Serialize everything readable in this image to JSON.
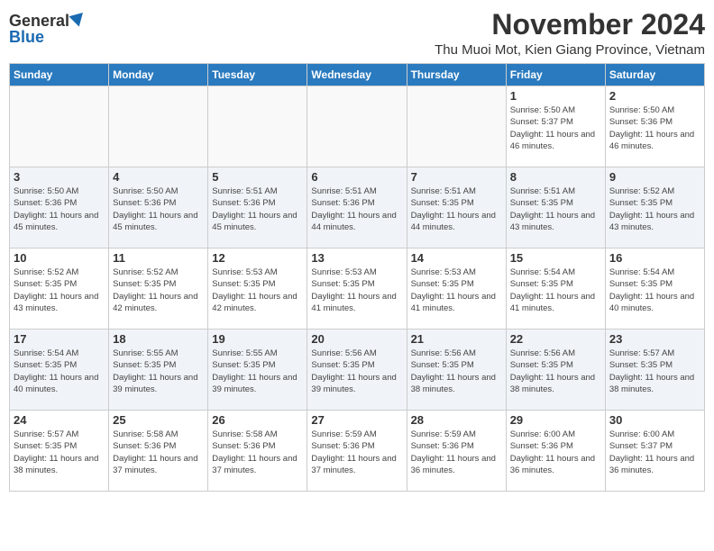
{
  "header": {
    "logo_general": "General",
    "logo_blue": "Blue",
    "month_title": "November 2024",
    "location": "Thu Muoi Mot, Kien Giang Province, Vietnam"
  },
  "columns": [
    "Sunday",
    "Monday",
    "Tuesday",
    "Wednesday",
    "Thursday",
    "Friday",
    "Saturday"
  ],
  "weeks": [
    {
      "days": [
        {
          "num": "",
          "detail": ""
        },
        {
          "num": "",
          "detail": ""
        },
        {
          "num": "",
          "detail": ""
        },
        {
          "num": "",
          "detail": ""
        },
        {
          "num": "",
          "detail": ""
        },
        {
          "num": "1",
          "detail": "Sunrise: 5:50 AM\nSunset: 5:37 PM\nDaylight: 11 hours and 46 minutes."
        },
        {
          "num": "2",
          "detail": "Sunrise: 5:50 AM\nSunset: 5:36 PM\nDaylight: 11 hours and 46 minutes."
        }
      ]
    },
    {
      "days": [
        {
          "num": "3",
          "detail": "Sunrise: 5:50 AM\nSunset: 5:36 PM\nDaylight: 11 hours and 45 minutes."
        },
        {
          "num": "4",
          "detail": "Sunrise: 5:50 AM\nSunset: 5:36 PM\nDaylight: 11 hours and 45 minutes."
        },
        {
          "num": "5",
          "detail": "Sunrise: 5:51 AM\nSunset: 5:36 PM\nDaylight: 11 hours and 45 minutes."
        },
        {
          "num": "6",
          "detail": "Sunrise: 5:51 AM\nSunset: 5:36 PM\nDaylight: 11 hours and 44 minutes."
        },
        {
          "num": "7",
          "detail": "Sunrise: 5:51 AM\nSunset: 5:35 PM\nDaylight: 11 hours and 44 minutes."
        },
        {
          "num": "8",
          "detail": "Sunrise: 5:51 AM\nSunset: 5:35 PM\nDaylight: 11 hours and 43 minutes."
        },
        {
          "num": "9",
          "detail": "Sunrise: 5:52 AM\nSunset: 5:35 PM\nDaylight: 11 hours and 43 minutes."
        }
      ]
    },
    {
      "days": [
        {
          "num": "10",
          "detail": "Sunrise: 5:52 AM\nSunset: 5:35 PM\nDaylight: 11 hours and 43 minutes."
        },
        {
          "num": "11",
          "detail": "Sunrise: 5:52 AM\nSunset: 5:35 PM\nDaylight: 11 hours and 42 minutes."
        },
        {
          "num": "12",
          "detail": "Sunrise: 5:53 AM\nSunset: 5:35 PM\nDaylight: 11 hours and 42 minutes."
        },
        {
          "num": "13",
          "detail": "Sunrise: 5:53 AM\nSunset: 5:35 PM\nDaylight: 11 hours and 41 minutes."
        },
        {
          "num": "14",
          "detail": "Sunrise: 5:53 AM\nSunset: 5:35 PM\nDaylight: 11 hours and 41 minutes."
        },
        {
          "num": "15",
          "detail": "Sunrise: 5:54 AM\nSunset: 5:35 PM\nDaylight: 11 hours and 41 minutes."
        },
        {
          "num": "16",
          "detail": "Sunrise: 5:54 AM\nSunset: 5:35 PM\nDaylight: 11 hours and 40 minutes."
        }
      ]
    },
    {
      "days": [
        {
          "num": "17",
          "detail": "Sunrise: 5:54 AM\nSunset: 5:35 PM\nDaylight: 11 hours and 40 minutes."
        },
        {
          "num": "18",
          "detail": "Sunrise: 5:55 AM\nSunset: 5:35 PM\nDaylight: 11 hours and 39 minutes."
        },
        {
          "num": "19",
          "detail": "Sunrise: 5:55 AM\nSunset: 5:35 PM\nDaylight: 11 hours and 39 minutes."
        },
        {
          "num": "20",
          "detail": "Sunrise: 5:56 AM\nSunset: 5:35 PM\nDaylight: 11 hours and 39 minutes."
        },
        {
          "num": "21",
          "detail": "Sunrise: 5:56 AM\nSunset: 5:35 PM\nDaylight: 11 hours and 38 minutes."
        },
        {
          "num": "22",
          "detail": "Sunrise: 5:56 AM\nSunset: 5:35 PM\nDaylight: 11 hours and 38 minutes."
        },
        {
          "num": "23",
          "detail": "Sunrise: 5:57 AM\nSunset: 5:35 PM\nDaylight: 11 hours and 38 minutes."
        }
      ]
    },
    {
      "days": [
        {
          "num": "24",
          "detail": "Sunrise: 5:57 AM\nSunset: 5:35 PM\nDaylight: 11 hours and 38 minutes."
        },
        {
          "num": "25",
          "detail": "Sunrise: 5:58 AM\nSunset: 5:36 PM\nDaylight: 11 hours and 37 minutes."
        },
        {
          "num": "26",
          "detail": "Sunrise: 5:58 AM\nSunset: 5:36 PM\nDaylight: 11 hours and 37 minutes."
        },
        {
          "num": "27",
          "detail": "Sunrise: 5:59 AM\nSunset: 5:36 PM\nDaylight: 11 hours and 37 minutes."
        },
        {
          "num": "28",
          "detail": "Sunrise: 5:59 AM\nSunset: 5:36 PM\nDaylight: 11 hours and 36 minutes."
        },
        {
          "num": "29",
          "detail": "Sunrise: 6:00 AM\nSunset: 5:36 PM\nDaylight: 11 hours and 36 minutes."
        },
        {
          "num": "30",
          "detail": "Sunrise: 6:00 AM\nSunset: 5:37 PM\nDaylight: 11 hours and 36 minutes."
        }
      ]
    }
  ]
}
